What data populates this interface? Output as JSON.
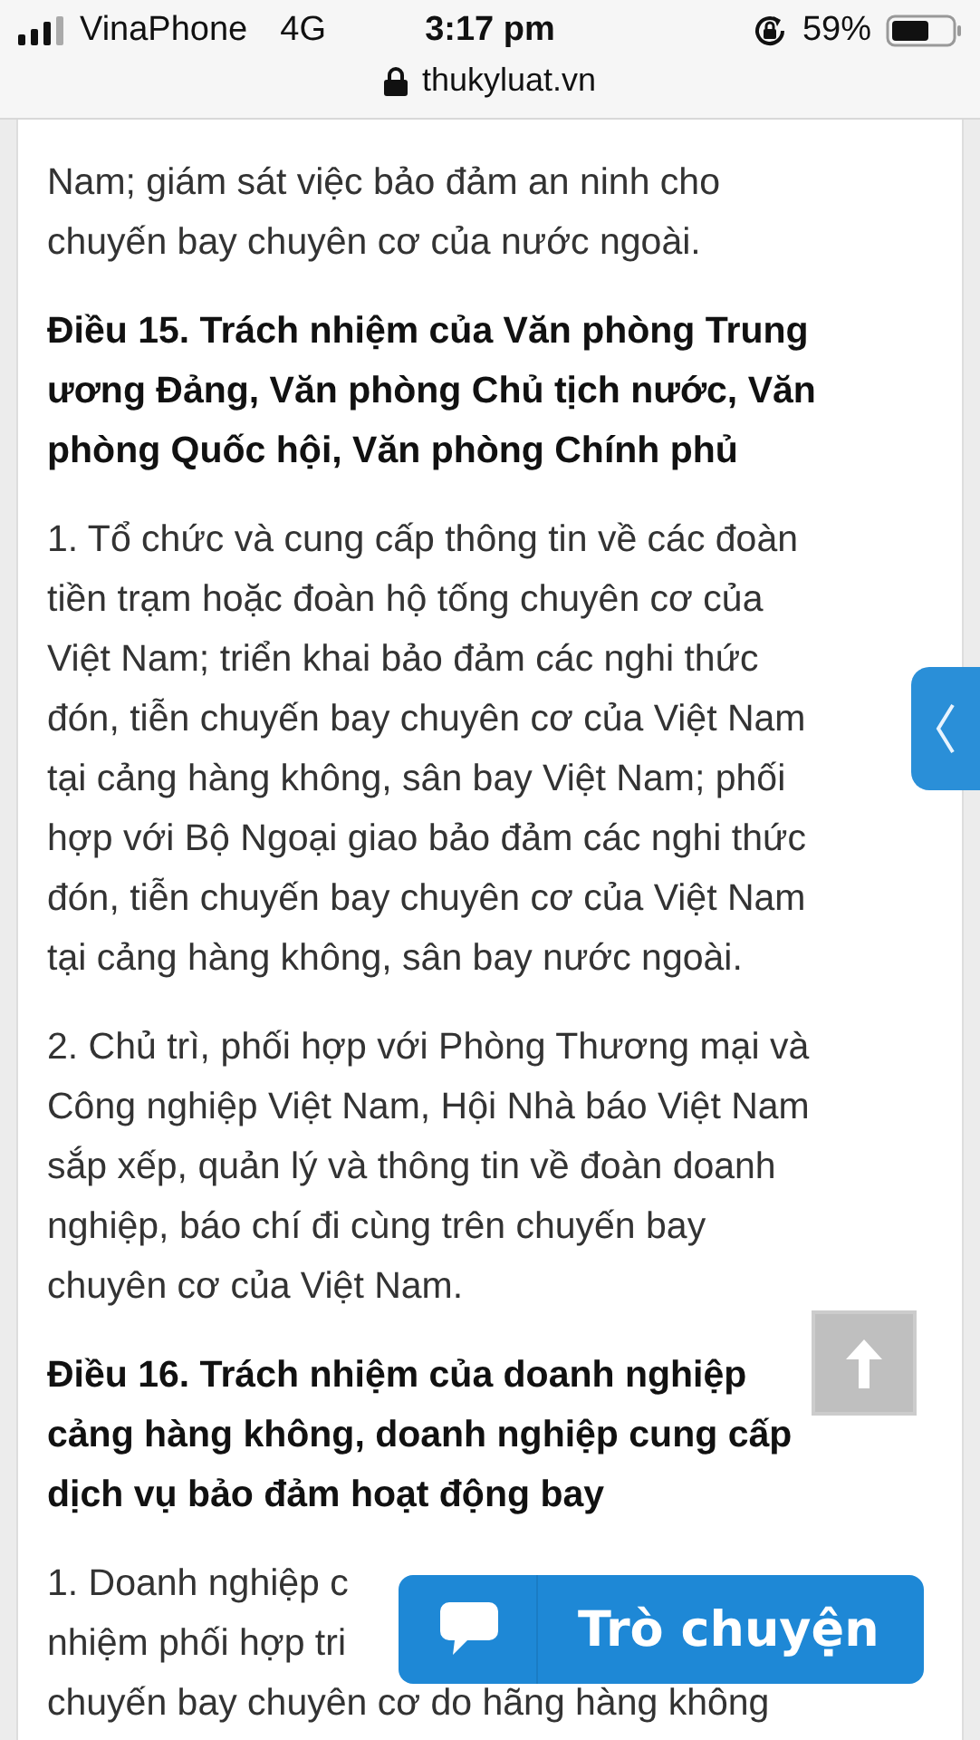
{
  "status_bar": {
    "carrier": "VinaPhone",
    "network": "4G",
    "time": "3:17 pm",
    "battery": "59%"
  },
  "address_bar": {
    "url": "thukyluat.vn"
  },
  "article": [
    {
      "kind": "paragraph",
      "lines": [
        "Nam; giám sát việc bảo đảm an ninh cho",
        "chuyến bay chuyên cơ của nước ngoài."
      ]
    },
    {
      "kind": "heading",
      "lines": [
        "Điều 15. Trách nhiệm của Văn phòng Trung",
        "ương Đảng, Văn phòng Chủ tịch nước, Văn",
        "phòng Quốc hội, Văn phòng Chính phủ"
      ]
    },
    {
      "kind": "paragraph",
      "lines": [
        "1. Tổ chức và cung cấp thông tin về các đoàn",
        "tiền trạm hoặc đoàn hộ tống chuyên cơ của",
        "Việt Nam; triển khai bảo đảm các nghi thức",
        "đón, tiễn chuyến bay chuyên cơ của Việt Nam",
        "tại cảng hàng không, sân bay Việt Nam; phối",
        "hợp với Bộ Ngoại giao bảo đảm các nghi thức",
        "đón, tiễn chuyến bay chuyên cơ của Việt Nam",
        "tại cảng hàng không, sân bay nước ngoài."
      ]
    },
    {
      "kind": "paragraph",
      "lines": [
        "2. Chủ trì, phối hợp với Phòng Thương mại và",
        "Công nghiệp Việt Nam, Hội Nhà báo Việt Nam",
        "sắp xếp, quản lý và thông tin về đoàn doanh",
        "nghiệp, báo chí đi cùng trên chuyến bay",
        "chuyên cơ của Việt Nam."
      ]
    },
    {
      "kind": "heading",
      "lines": [
        "Điều 16. Trách nhiệm của doanh nghiệp",
        "cảng hàng không, doanh nghiệp cung cấp",
        "dịch vụ bảo đảm hoạt động bay"
      ]
    },
    {
      "kind": "covered",
      "lines": [
        "1. Doanh nghiệp c",
        "nhiệm phối hợp tri",
        "chuyến bay chuyên cơ do hãng hàng không"
      ]
    }
  ],
  "chat_button": {
    "label": "Trò chuyện"
  }
}
